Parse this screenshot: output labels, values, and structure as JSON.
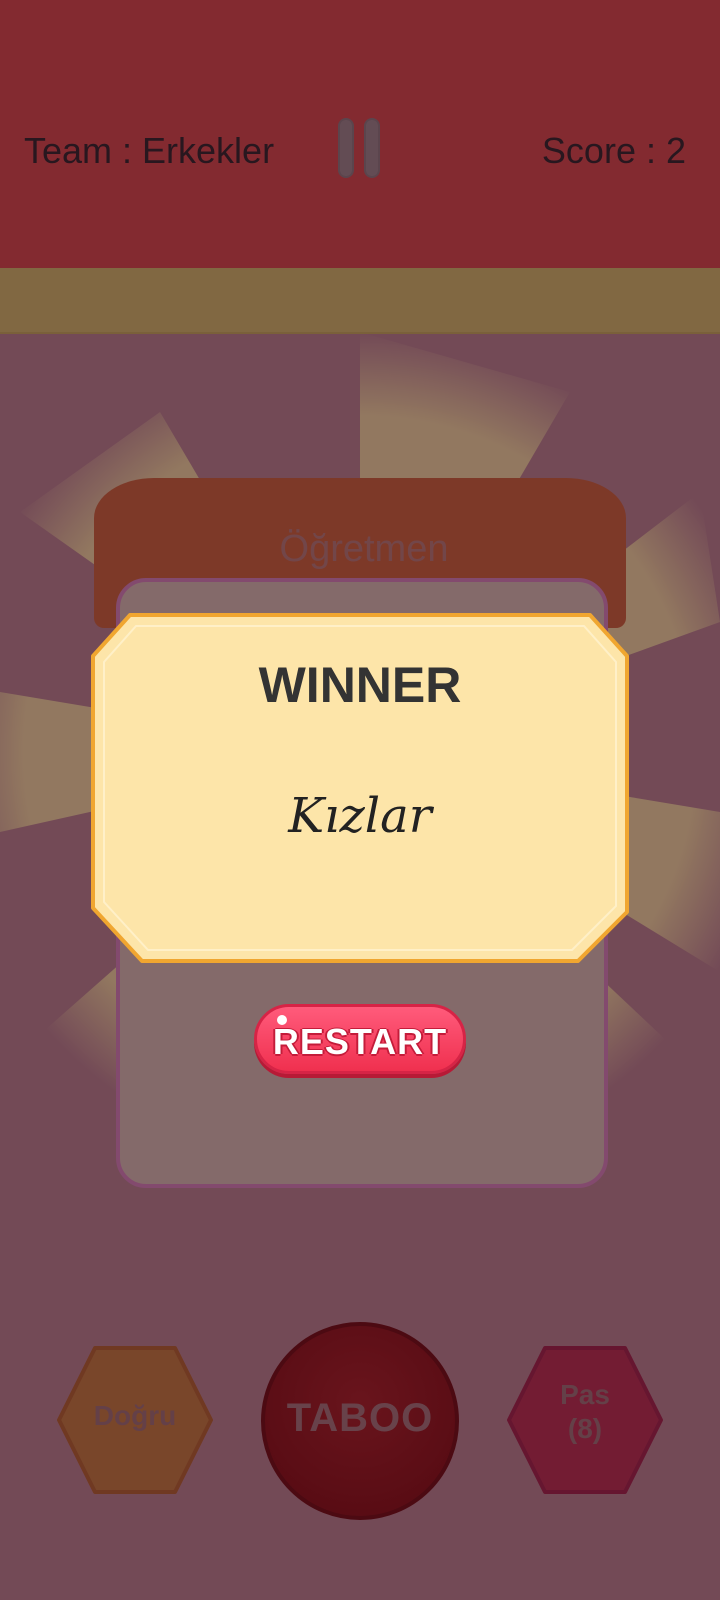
{
  "header": {
    "team_label": "Team : Erkekler",
    "score_label": "Score : 2"
  },
  "card": {
    "word": "Öğretmen"
  },
  "winner_popup": {
    "title": "WINNER",
    "winning_team": "Kızlar",
    "restart_label": "RESTART"
  },
  "controls": {
    "correct_label": "Doğru",
    "taboo_label": "TABOO",
    "pass_label": "Pas",
    "pass_count": "(8)"
  },
  "colors": {
    "header": "#d64e4a",
    "timer_bar": "#d3c46b",
    "popup": "#fde5a9",
    "restart": "#f0304f",
    "taboo": "#8b1616"
  }
}
